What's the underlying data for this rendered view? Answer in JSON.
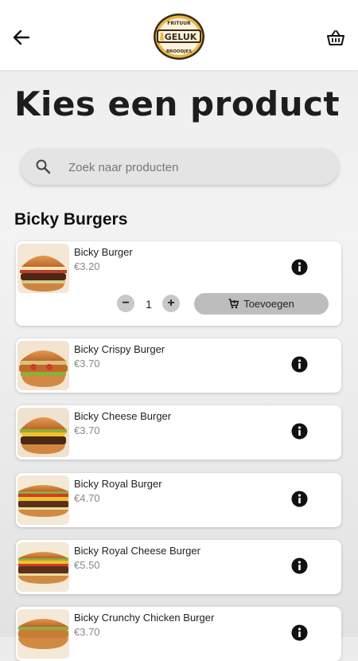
{
  "header": {
    "logo": {
      "top_text": "FRITUUR",
      "name": "GELUK",
      "bottom_text": "BROODJES"
    }
  },
  "page_title": "Kies een product",
  "search": {
    "placeholder": "Zoek naar producten",
    "value": ""
  },
  "section_title": "Bicky Burgers",
  "products": [
    {
      "name": "Bicky Burger",
      "price": "€3.20",
      "expanded": true,
      "quantity": "1",
      "add_label": "Toevoegen"
    },
    {
      "name": "Bicky Crispy Burger",
      "price": "€3.70"
    },
    {
      "name": "Bicky Cheese Burger",
      "price": "€3.70"
    },
    {
      "name": "Bicky Royal Burger",
      "price": "€4.70"
    },
    {
      "name": "Bicky Royal Cheese Burger",
      "price": "€5.50"
    },
    {
      "name": "Bicky Crunchy Chicken Burger",
      "price": "€3.70"
    }
  ],
  "colors": {
    "logo_gold": "#e8b64a",
    "logo_dark": "#3a2a14",
    "button_grey": "#bdbdbd"
  },
  "icons": {
    "back": "arrow-left-icon",
    "cart": "basket-icon",
    "search": "search-icon",
    "info": "info-icon",
    "add": "cart-plus-icon"
  }
}
